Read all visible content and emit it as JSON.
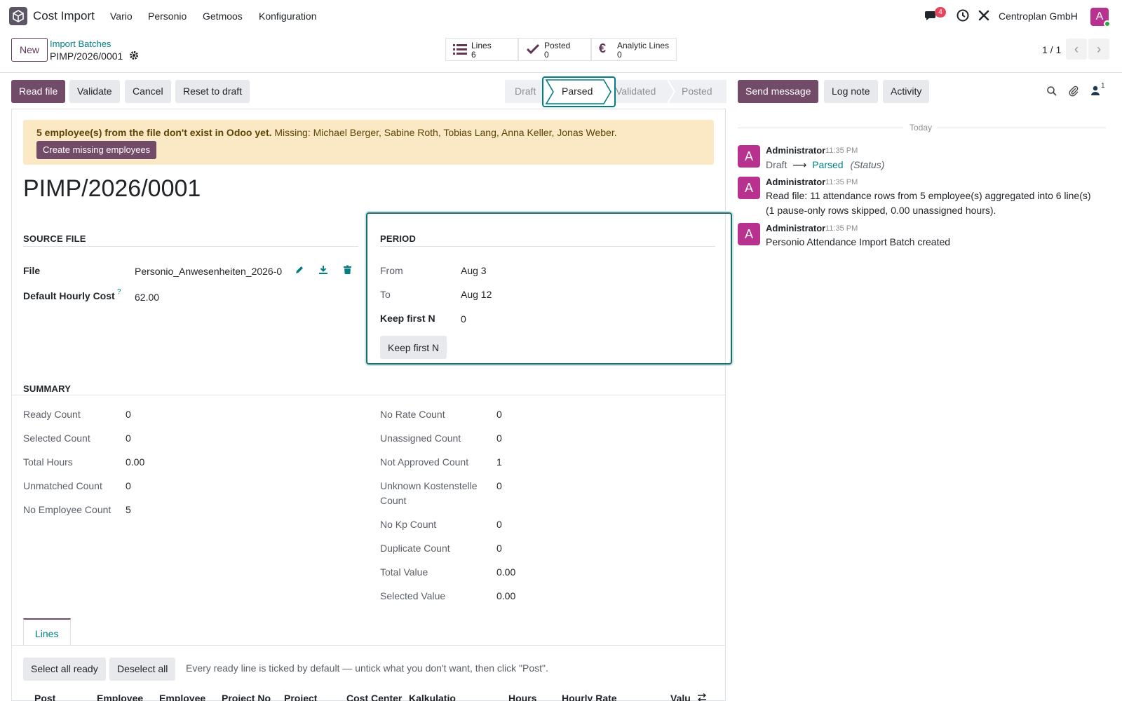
{
  "app": {
    "name": "Cost Import",
    "menu": [
      "Vario",
      "Personio",
      "Getmoos",
      "Konfiguration"
    ],
    "company": "Centroplan GmbH",
    "avatar_letter": "A",
    "messages_badge": "4",
    "brand_color": "#714b67",
    "accent_color": "#017e84"
  },
  "control": {
    "new_label": "New",
    "breadcrumb_parent": "Import Batches",
    "breadcrumb_current": "PIMP/2026/0001",
    "smart_buttons": [
      {
        "label": "Lines",
        "value": "6",
        "icon": "list-icon"
      },
      {
        "label": "Posted",
        "value": "0",
        "icon": "check-icon"
      },
      {
        "label": "Analytic Lines",
        "value": "0",
        "icon": "euro-icon"
      }
    ],
    "pager": "1 / 1"
  },
  "statusbar": {
    "buttons": [
      "Read file",
      "Validate",
      "Cancel",
      "Reset to draft"
    ],
    "stages": [
      "Draft",
      "Parsed",
      "Validated",
      "Posted"
    ],
    "active_stage": "Parsed"
  },
  "alert": {
    "bold": "5 employee(s) from the file don't exist in Odoo yet.",
    "text": " Missing: Michael Berger, Sabine Roth, Tobias Lang, Anna Keller, Jonas Weber.",
    "button": "Create missing employees"
  },
  "form": {
    "title": "PIMP/2026/0001",
    "source_file": {
      "heading": "SOURCE FILE",
      "file_label": "File",
      "file_value": "Personio_Anwesenheiten_2026-0",
      "hourly_label": "Default Hourly Cost",
      "hourly_help": "?",
      "hourly_value": "62.00"
    },
    "period": {
      "heading": "PERIOD",
      "from_label": "From",
      "from_value": "Aug 3",
      "to_label": "To",
      "to_value": "Aug 12",
      "keep_label": "Keep first N",
      "keep_value": "0",
      "keep_button": "Keep first N"
    },
    "summary": {
      "heading": "SUMMARY",
      "left": [
        {
          "label": "Ready Count",
          "value": "0"
        },
        {
          "label": "Selected Count",
          "value": "0"
        },
        {
          "label": "Total Hours",
          "value": "0.00"
        },
        {
          "label": "Unmatched Count",
          "value": "0"
        },
        {
          "label": "No Employee Count",
          "value": "5"
        }
      ],
      "right": [
        {
          "label": "No Rate Count",
          "value": "0"
        },
        {
          "label": "Unassigned Count",
          "value": "0"
        },
        {
          "label": "Not Approved Count",
          "value": "1"
        },
        {
          "label": "Unknown Kostenstelle",
          "label2": "Count",
          "value": "0"
        },
        {
          "label": "No Kp Count",
          "value": "0"
        },
        {
          "label": "Duplicate Count",
          "value": "0"
        },
        {
          "label": "Total Value",
          "value": "0.00"
        },
        {
          "label": "Selected Value",
          "value": "0.00"
        }
      ]
    },
    "lines_tab": "Lines",
    "select_all": "Select all ready",
    "deselect_all": "Deselect all",
    "hint": "Every ready line is ticked by default — untick what you don't want, then click \"Post\".",
    "columns": [
      "Post",
      "Employee",
      "Employee",
      "Project No",
      "Project",
      "Cost Center",
      "Kalkulatio",
      "Hours",
      "Hourly Rate",
      "Valu"
    ]
  },
  "chatter": {
    "send_message": "Send message",
    "log_note": "Log note",
    "activity": "Activity",
    "followers_count": "1",
    "today": "Today",
    "messages": [
      {
        "author": "Administrator",
        "time": "11:35 PM",
        "from": "Draft",
        "to": "Parsed",
        "field": "(Status)"
      },
      {
        "author": "Administrator",
        "time": "11:35 PM",
        "line1": "Read file: 11 attendance rows from 5 employee(s) aggregated into 6 line(s)",
        "line2": "(1 pause-only rows skipped, 0.00 unassigned hours)."
      },
      {
        "author": "Administrator",
        "time": "11:35 PM",
        "body": "Personio Attendance Import Batch created"
      }
    ]
  }
}
